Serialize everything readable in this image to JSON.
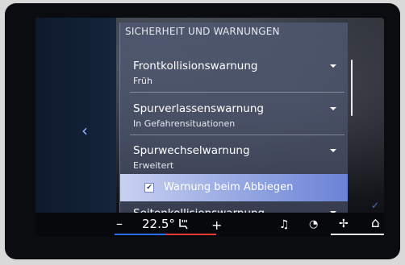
{
  "settings": {
    "section_title": "SICHERHEIT UND WARNUNGEN",
    "items": [
      {
        "title": "Frontkollisionswarnung",
        "value": "Früh"
      },
      {
        "title": "Spurverlassenswarnung",
        "value": "In Gefahrensituationen"
      },
      {
        "title": "Spurwechselwarnung",
        "value": "Erweitert"
      }
    ],
    "checkbox": {
      "label": "Warnung beim Abbiegen",
      "checked": true,
      "mark": "✔"
    },
    "partial_item": {
      "title": "Seitenkollisionswarnung"
    }
  },
  "climate": {
    "minus": "–",
    "temperature": "22.5°",
    "seat_icon": "seat-heat-icon",
    "plus": "+"
  },
  "nav": {
    "back_icon": "chevron-left-icon",
    "back_symbol": "‹",
    "music_symbol": "♫",
    "gauge_symbol": "◔",
    "fan_symbol": "✢",
    "home_symbol": "⌂",
    "icons": [
      "music-icon",
      "gauge-icon",
      "fan-icon",
      "home-icon"
    ]
  },
  "colors": {
    "accent": "#6b82d6",
    "temp_blue": "#2d6df2",
    "temp_red": "#e63a3a"
  }
}
